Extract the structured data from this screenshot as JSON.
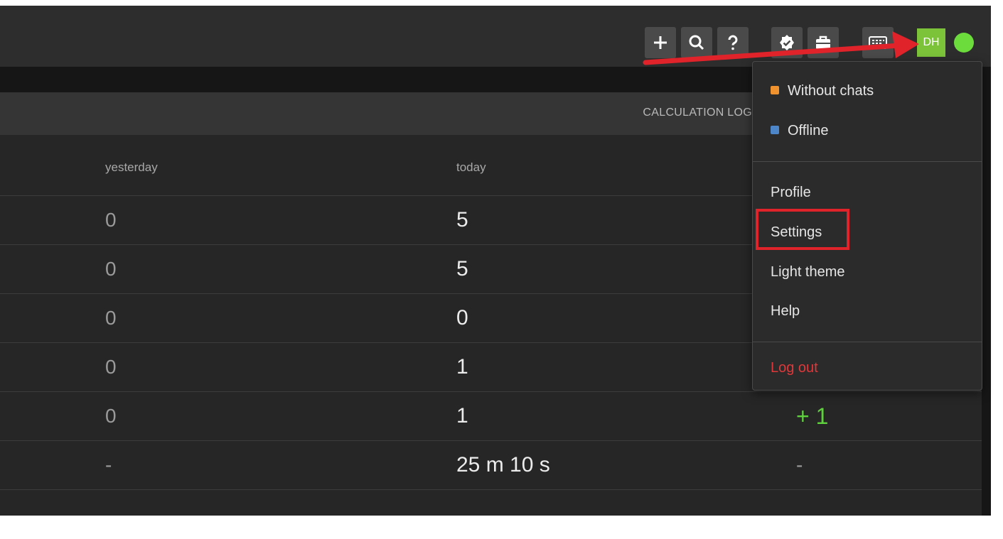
{
  "toolbar": {
    "buttons": [
      {
        "name": "plus-icon",
        "label": "+"
      },
      {
        "name": "search-icon",
        "label": "search"
      },
      {
        "name": "help-icon",
        "label": "?"
      },
      {
        "name": "verified-badge-icon",
        "label": "verified"
      },
      {
        "name": "briefcase-icon",
        "label": "briefcase"
      },
      {
        "name": "keyboard-icon",
        "label": "keyboard"
      }
    ],
    "avatar_initials": "DH",
    "status_color": "#6cdc3c"
  },
  "table": {
    "header_title": "CALCULATION LOG",
    "columns": [
      "yesterday",
      "today"
    ],
    "rows": [
      {
        "yesterday": "0",
        "today": "5",
        "delta": ""
      },
      {
        "yesterday": "0",
        "today": "5",
        "delta": ""
      },
      {
        "yesterday": "0",
        "today": "0",
        "delta": ""
      },
      {
        "yesterday": "0",
        "today": "1",
        "delta": ""
      },
      {
        "yesterday": "0",
        "today": "1",
        "delta": "+ 1"
      },
      {
        "yesterday": "-",
        "today": "25 m 10 s",
        "delta": "-"
      }
    ]
  },
  "menu": {
    "statuses": [
      {
        "label": "Without chats",
        "color": "#f0922e"
      },
      {
        "label": "Offline",
        "color": "#4d86c9"
      }
    ],
    "items": [
      "Profile",
      "Settings",
      "Light theme",
      "Help"
    ],
    "logout": "Log out",
    "highlighted": "Settings"
  },
  "colors": {
    "annotation_red": "#e0222a",
    "positive_green": "#5fd13e"
  }
}
